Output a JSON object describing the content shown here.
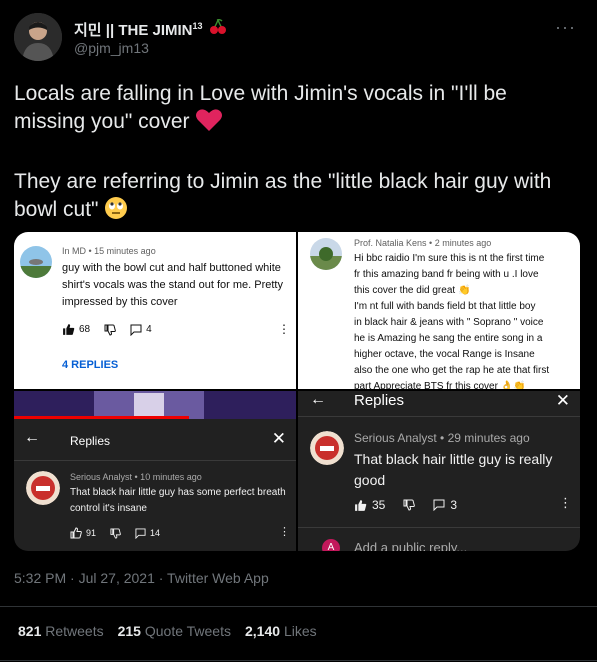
{
  "user": {
    "display_name": "지민 || THE JIMIN",
    "superscript": "13",
    "handle": "@pjm_jm13"
  },
  "tweet": {
    "line1": "Locals are falling in Love with Jimin's vocals in \"I'll be missing you\" cover",
    "line2": "They are referring to Jimin as the \"little black hair guy with bowl cut\"",
    "meta": "5:32 PM · Jul 27, 2021 · Twitter Web App"
  },
  "panel1": {
    "author_time": "In MD • 15 minutes ago",
    "text": "guy with the bowl cut and half buttoned white shirt's vocals was the stand out for me. Pretty impressed by this cover",
    "likes": "68",
    "replies_count": "4",
    "replies_link": "4 REPLIES"
  },
  "panel2": {
    "author_time": "Prof. Natalia Kens • 2 minutes ago",
    "text_lines": [
      "Hi bbc raidio I'm sure this is nt the first time",
      "fr this amazing band fr being with u .I love",
      "this cover the did great 👏",
      " I'm nt full with bands  field bt that little boy",
      "in black hair &  jeans  with  \" Soprano \" voice",
      "he is Amazing he sang the entire song in a",
      "higher octave, the vocal Range is Insane",
      "also the one who get the rap he ate that first",
      "part  Appreciate BTS fr this cover 👌👏"
    ]
  },
  "panel3": {
    "header": "Replies",
    "author_time": "Serious Analyst • 10 minutes ago",
    "text": "That black hair little guy has some perfect breath control it's insane",
    "likes": "91",
    "replies_count": "14"
  },
  "panel4": {
    "header": "Replies",
    "author_time": "Serious Analyst • 29 minutes ago",
    "text": "That black hair little guy is really good",
    "likes": "35",
    "replies_count": "3",
    "add_reply": "Add a public reply...",
    "avatar_letter": "A"
  },
  "stats": {
    "retweets_count": "821",
    "retweets_label": "Retweets",
    "quotes_count": "215",
    "quotes_label": "Quote Tweets",
    "likes_count": "2,140",
    "likes_label": "Likes"
  }
}
